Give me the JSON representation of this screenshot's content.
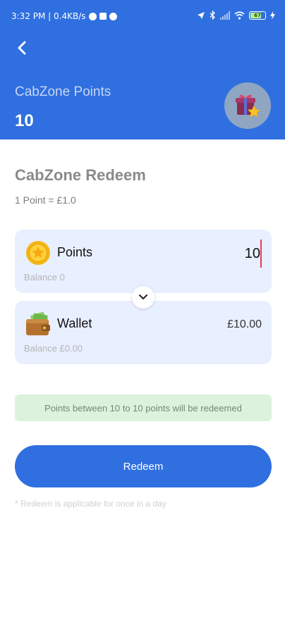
{
  "status_bar": {
    "time_info": "3:32 PM | 0.4KB/s",
    "battery": "67"
  },
  "header": {
    "title": "CabZone Points",
    "points": "10"
  },
  "redeem": {
    "title": "CabZone Redeem",
    "rate": "1 Point = £1.0"
  },
  "points_card": {
    "label": "Points",
    "value": "10",
    "balance": "Balance 0"
  },
  "wallet_card": {
    "label": "Wallet",
    "amount": "£10.00",
    "balance": "Balance £0.00"
  },
  "notice": "Points between 10 to 10 points will be redeemed",
  "button": {
    "label": "Redeem"
  },
  "footnote": "* Redeem is applicable for once in a day",
  "colors": {
    "primary": "#2f6fe0",
    "card_bg": "#e8efff",
    "notice_bg": "#dcf2dc"
  },
  "icons": [
    "back-arrow-icon",
    "gift-star-icon",
    "coin-star-icon",
    "wallet-icon",
    "chevron-down-icon"
  ]
}
